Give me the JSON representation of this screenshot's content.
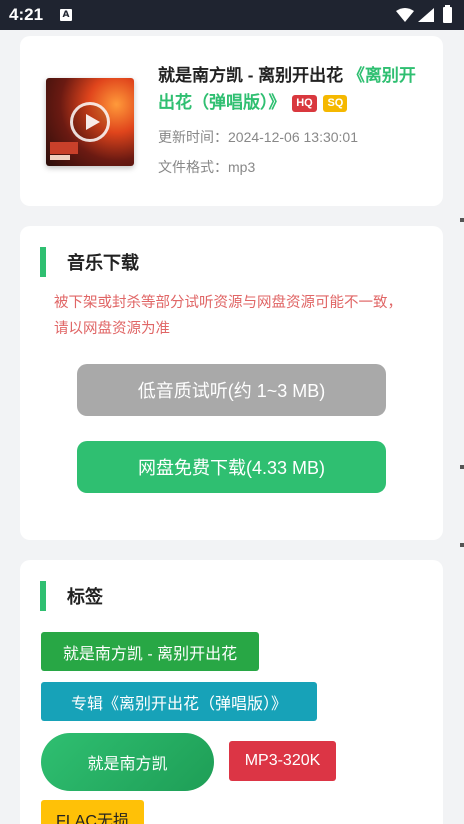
{
  "status_bar": {
    "time": "4:21",
    "notification_icon": "A",
    "icons": [
      "wifi-icon",
      "signal-icon",
      "battery-icon"
    ]
  },
  "song": {
    "title": "就是南方凯 - 离别开出花",
    "album": "《离别开出花（弹唱版）》",
    "badges": [
      "HQ",
      "SQ"
    ],
    "updated_label": "更新时间：2024-12-06 13:30:01",
    "format_label": "文件格式：mp3"
  },
  "download": {
    "section_title": "音乐下载",
    "notice": "被下架或封杀等部分试听资源与网盘资源可能不一致，请以网盘资源为准",
    "trial_button": "低音质试听(约 1~3 MB)",
    "netdisk_button": "网盘免费下载(4.33 MB)"
  },
  "tags": {
    "section_title": "标签",
    "items": [
      "就是南方凯 - 离别开出花",
      "专辑《离别开出花（弹唱版）》",
      "就是南方凯",
      "MP3-320K",
      "FLAC无损"
    ]
  },
  "colors": {
    "accent": "#2fbf71",
    "warning_text": "#e06666",
    "hq": "#d9383e",
    "sq": "#f5b800"
  }
}
